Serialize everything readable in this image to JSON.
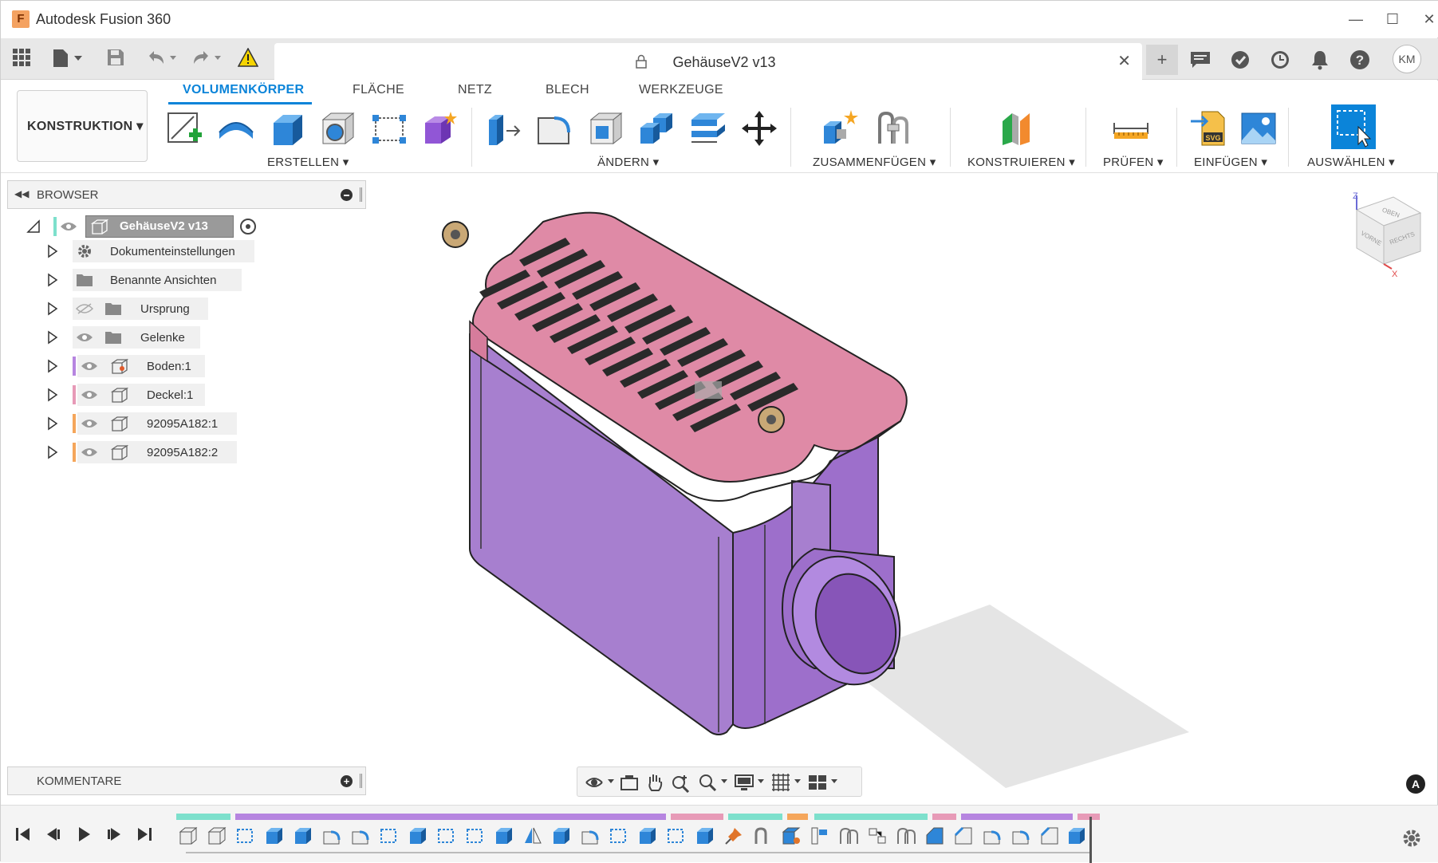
{
  "app": {
    "title": "Autodesk Fusion 360",
    "logo_letter": "F"
  },
  "window": {
    "minimize": "—",
    "maximize": "☐",
    "close": "✕"
  },
  "document": {
    "title": "GehäuseV2 v13",
    "close": "✕"
  },
  "user": {
    "initials": "KM"
  },
  "toolbar": {
    "workspace": "KONSTRUKTION ▾",
    "tabs": [
      "VOLUMENKÖRPER",
      "FLÄCHE",
      "NETZ",
      "BLECH",
      "WERKZEUGE"
    ],
    "groups": {
      "erstellen": "ERSTELLEN ▾",
      "aendern": "ÄNDERN ▾",
      "zusammenfuegen": "ZUSAMMENFÜGEN ▾",
      "konstruieren": "KONSTRUIEREN ▾",
      "pruefen": "PRÜFEN ▾",
      "einfuegen": "EINFÜGEN ▾",
      "auswaehlen": "AUSWÄHLEN ▾"
    }
  },
  "browser": {
    "title": "BROWSER",
    "root": "GehäuseV2 v13",
    "items": [
      {
        "label": "Dokumenteinstellungen"
      },
      {
        "label": "Benannte Ansichten"
      },
      {
        "label": "Ursprung"
      },
      {
        "label": "Gelenke"
      },
      {
        "label": "Boden:1"
      },
      {
        "label": "Deckel:1"
      },
      {
        "label": "92095A182:1"
      },
      {
        "label": "92095A182:2"
      }
    ]
  },
  "comments": {
    "title": "KOMMENTARE"
  },
  "viewcube": {
    "top": "OBEN",
    "front": "VORNE",
    "right": "RECHTS",
    "axis_z": "Z",
    "axis_x": "X"
  },
  "colors": {
    "accent": "#0b84d9",
    "body_purple": "#a77fcf",
    "lid_pink": "#df8aa6",
    "timeline_teal": "#7de0cc",
    "timeline_purple": "#b685e0",
    "timeline_pink": "#e79ab7",
    "timeline_orange": "#f5a65b"
  },
  "statusbadge": {
    "letter": "A"
  }
}
